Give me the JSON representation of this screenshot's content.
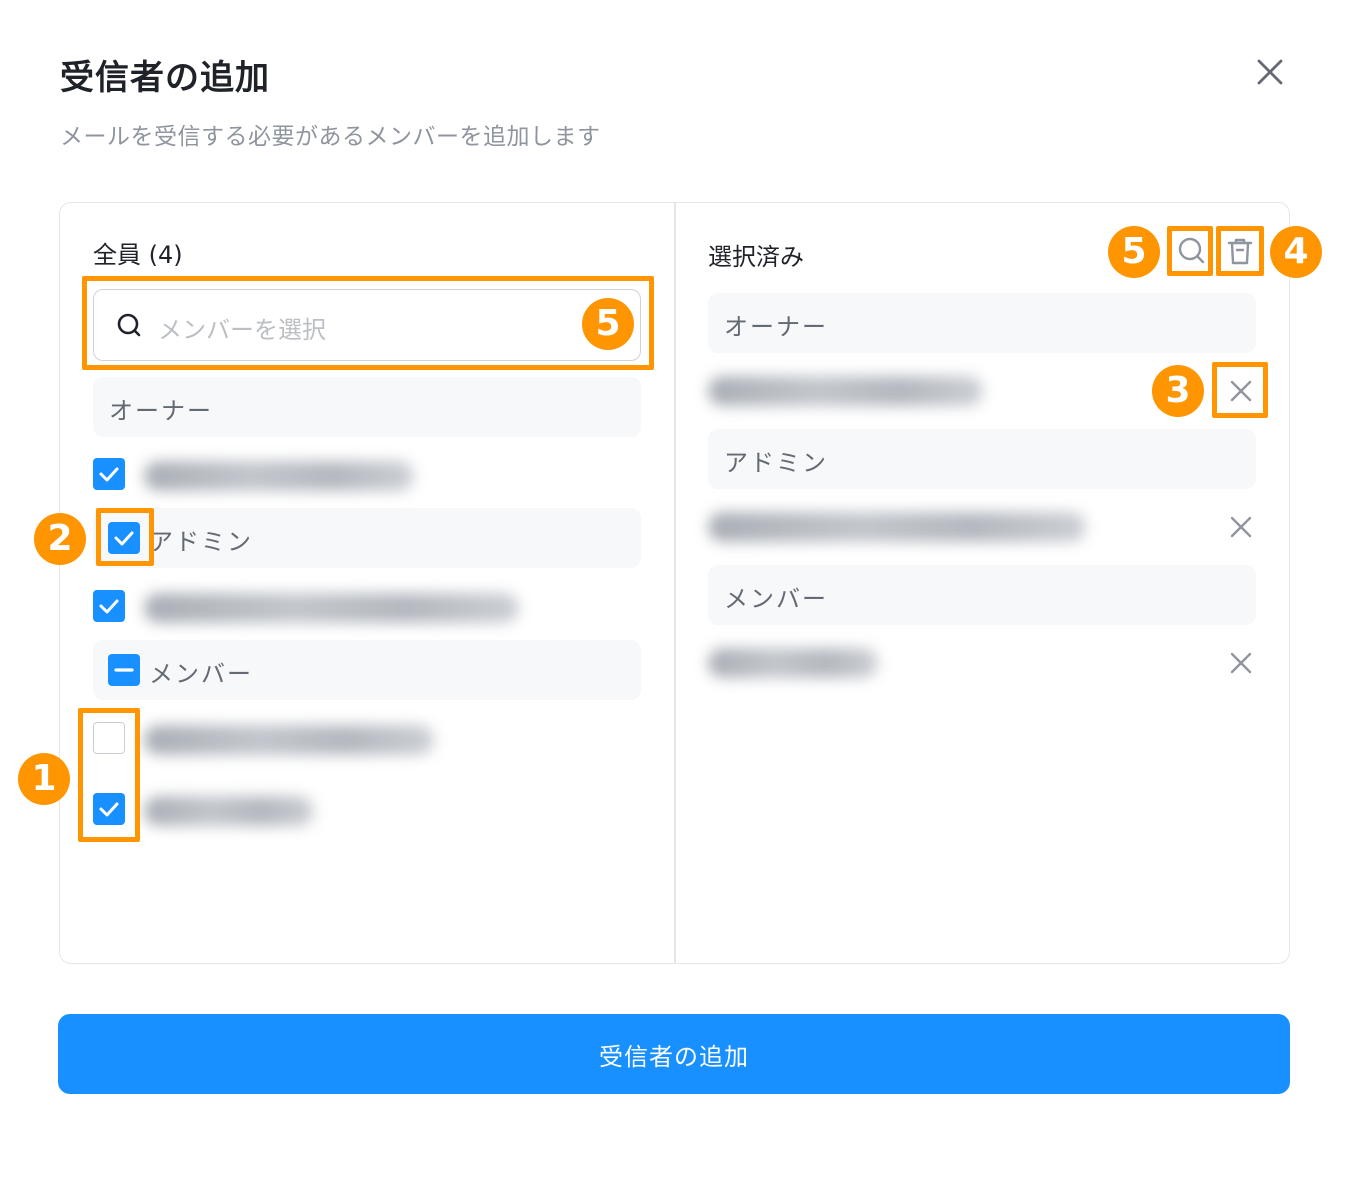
{
  "dialog": {
    "title": "受信者の追加",
    "subtitle": "メールを受信する必要があるメンバーを追加します",
    "close_icon": "close-icon"
  },
  "left_panel": {
    "title": "全員 (4)",
    "search_placeholder": "メンバーを選択",
    "groups": [
      {
        "label": "オーナー",
        "checkbox": null,
        "members": [
          {
            "checked": true,
            "blurred": true
          }
        ]
      },
      {
        "label": "アドミン",
        "checkbox": "checked",
        "members": [
          {
            "checked": true,
            "blurred": true
          }
        ]
      },
      {
        "label": "メンバー",
        "checkbox": "indeterminate",
        "members": [
          {
            "checked": false,
            "blurred": true
          },
          {
            "checked": true,
            "blurred": true
          }
        ]
      }
    ]
  },
  "right_panel": {
    "title": "選択済み",
    "search_icon": "search-icon",
    "clear_icon": "trash-icon",
    "groups": [
      {
        "label": "オーナー",
        "members": [
          {
            "blurred": true
          }
        ]
      },
      {
        "label": "アドミン",
        "members": [
          {
            "blurred": true
          }
        ]
      },
      {
        "label": "メンバー",
        "members": [
          {
            "blurred": true
          }
        ]
      }
    ]
  },
  "annotations": {
    "badges": [
      "1",
      "2",
      "3",
      "4",
      "5",
      "5"
    ],
    "color": "#ff9500"
  },
  "colors": {
    "primary": "#1890ff",
    "annotation": "#ff9500",
    "border": "#e4e6ea",
    "group_bg": "#f7f8f9"
  },
  "submit_label": "受信者の追加"
}
